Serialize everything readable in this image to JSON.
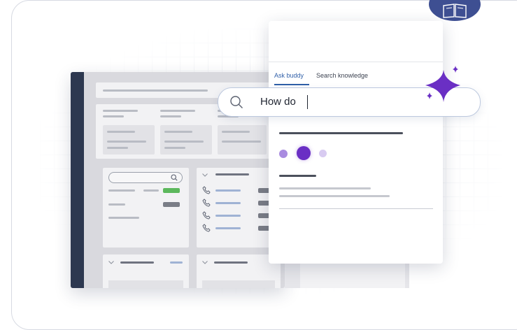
{
  "panel": {
    "tabs": [
      {
        "label": "Ask buddy",
        "active": true
      },
      {
        "label": "Search knowledge",
        "active": false
      }
    ]
  },
  "search": {
    "value": "How do"
  },
  "icons": {
    "search": "search-icon",
    "sparkle": "sparkle-icon",
    "book": "book-icon",
    "phone": "phone-icon"
  },
  "colors": {
    "accent_blue": "#2f5fa8",
    "sparkle_purple": "#6a2fc4",
    "dot_purple": "#7b3fd1",
    "sidebar_dark": "#2d3850",
    "status_green": "#5cb85c",
    "badge_navy": "#3e4f92"
  }
}
